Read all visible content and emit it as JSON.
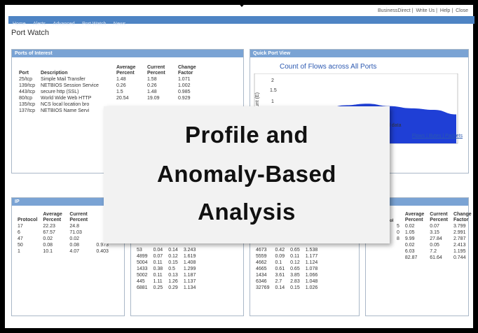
{
  "header": {
    "links": [
      "BusinessDirect",
      "Write Us",
      "Help",
      "Close"
    ]
  },
  "nav": {
    "items": [
      "Home",
      "Alerts",
      "Advanced",
      "Port Watch",
      "News"
    ]
  },
  "page_title": "Port Watch",
  "ports_panel": {
    "title": "Ports of Interest",
    "headers": [
      "Port",
      "Description",
      "Average Percent",
      "Current Percent",
      "Change Factor"
    ],
    "rows": [
      [
        "25/tcp",
        "Simple Mail Transfer",
        "1.48",
        "1.58",
        "1.071"
      ],
      [
        "139/tcp",
        "NETBIOS Session Service",
        "0.26",
        "0.26",
        "1.002"
      ],
      [
        "443/tcp",
        "secure http (SSL)",
        "1.5",
        "1.48",
        "0.985"
      ],
      [
        "80/tcp",
        "World Wide Web HTTP",
        "20.54",
        "19.09",
        "0.929"
      ],
      [
        "135/tcp",
        "NCS local location bro",
        "",
        "",
        ""
      ],
      [
        "137/tcp",
        "NETBIOS Name Servi",
        "",
        "",
        ""
      ]
    ]
  },
  "quick_view": {
    "title": "Quick Port View",
    "chart_title": "Count of Flows across All Ports",
    "y_ticks": [
      "2",
      "1.5",
      "1"
    ],
    "ylabel": "ount (E)",
    "partial_text": "tial data",
    "links": [
      "Flows",
      "Bytes",
      "Packets"
    ]
  },
  "ip_panel": {
    "title": "IP",
    "headers": [
      "Protocol",
      "Average Percent",
      "Current Percent",
      ""
    ],
    "rows": [
      [
        "17",
        "22.23",
        "24.8",
        ""
      ],
      [
        "6",
        "67.57",
        "71.03",
        ""
      ],
      [
        "47",
        "0.02",
        "0.02",
        ""
      ],
      [
        "50",
        "0.08",
        "0.08",
        "0.973"
      ],
      [
        "1",
        "10.1",
        "4.07",
        "0.403"
      ]
    ]
  },
  "mid_panel_rows": [
    [
      "53",
      "0.04",
      "0.14",
      "3.243"
    ],
    [
      "4899",
      "0.07",
      "0.12",
      "1.619"
    ],
    [
      "5004",
      "0.11",
      "0.15",
      "1.408"
    ],
    [
      "1433",
      "0.38",
      "0.5",
      "1.299"
    ],
    [
      "5002",
      "0.11",
      "0.13",
      "1.187"
    ],
    [
      "445",
      "1.11",
      "1.26",
      "1.137"
    ],
    [
      "6881",
      "0.25",
      "0.29",
      "1.134"
    ]
  ],
  "mid2_panel_rows": [
    [
      "4673",
      "0.42",
      "0.65",
      "1.538"
    ],
    [
      "5559",
      "0.09",
      "0.11",
      "1.177"
    ],
    [
      "4662",
      "0.1",
      "0.12",
      "1.124"
    ],
    [
      "4665",
      "0.61",
      "0.65",
      "1.078"
    ],
    [
      "1434",
      "3.61",
      "3.85",
      "1.066"
    ],
    [
      "6346",
      "2.7",
      "2.83",
      "1.048"
    ],
    [
      "32769",
      "0.14",
      "0.15",
      "1.026"
    ]
  ],
  "right_panel": {
    "col_label": "ol",
    "headers": [
      "Average Percent",
      "Current Percent",
      "Change Factor"
    ],
    "rows": [
      [
        "5",
        "0.02",
        "0.07",
        "3.799"
      ],
      [
        "0",
        "1.05",
        "3.15",
        "2.991"
      ],
      [
        "8",
        "9.99",
        "27.84",
        "2.787"
      ],
      [
        "",
        "0.02",
        "0.05",
        "2.413"
      ],
      [
        "",
        "6.03",
        "7.2",
        "1.195"
      ],
      [
        "",
        "82.87",
        "61.64",
        "0.744"
      ]
    ]
  },
  "overlay": {
    "line1": "Profile and",
    "line2": "Anomaly-Based",
    "line3": "Analysis"
  },
  "chart_data": {
    "type": "area",
    "title": "Count of Flows across All Ports",
    "ylabel": "",
    "x": [
      0,
      1,
      2,
      3,
      4,
      5,
      6,
      7,
      8
    ],
    "values": [
      0.2,
      0.8,
      1.1,
      1.25,
      1.3,
      1.22,
      1.15,
      1.1,
      0.95
    ],
    "ylim": [
      0,
      2.2
    ]
  },
  "colors": {
    "nav": "#4e84c4",
    "panel_header": "#7aa3d4",
    "chart_fill": "#1f3fd6"
  }
}
